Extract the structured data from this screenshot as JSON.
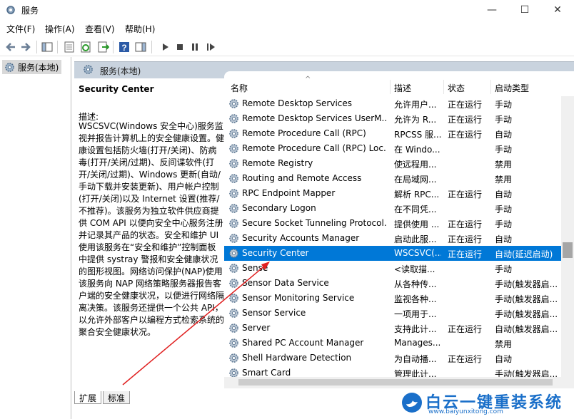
{
  "window": {
    "title": "服务",
    "minimize_glyph": "—",
    "maximize_glyph": "☐",
    "close_glyph": "✕"
  },
  "menu": [
    "文件(F)",
    "操作(A)",
    "查看(V)",
    "帮助(H)"
  ],
  "toolbar": {
    "icons": [
      "back-arrow-icon",
      "forward-arrow-icon",
      "show-hide-tree-icon",
      "properties-icon",
      "refresh-icon",
      "export-list-icon",
      "help-icon",
      "show-action-pane-icon",
      "start-service-icon",
      "stop-service-icon",
      "pause-service-icon",
      "restart-service-icon"
    ]
  },
  "tree": {
    "root_label": "服务(本地)"
  },
  "right_header": {
    "label": "服务(本地)"
  },
  "selected_service": {
    "title": "Security Center",
    "desc_label": "描述:",
    "description": "WSCSVC(Windows 安全中心)服务监视并报告计算机上的安全健康设置。健康设置包括防火墙(打开/关闭)、防病毒(打开/关闭/过期)、反间谍软件(打开/关闭/过期)、Windows 更新(自动/手动下载并安装更新)、用户帐户控制(打开/关闭)以及 Internet 设置(推荐/不推荐)。该服务为独立软件供应商提供 COM API 以便向安全中心服务注册并记录其产品的状态。安全和维护 UI 使用该服务在“安全和维护”控制面板中提供 systray 警报和安全健康状况的图形视图。网络访问保护(NAP)使用该服务向 NAP 网络策略服务器报告客户端的安全健康状况，以便进行网络隔离决策。该服务还提供一个公共 API，以允许外部客户以编程方式检索系统的聚合安全健康状况。"
  },
  "list": {
    "columns": {
      "name": "名称",
      "desc": "描述",
      "status": "状态",
      "startup": "启动类型"
    },
    "sort_arrow": "^",
    "rows": [
      {
        "name": "Remote Desktop Services",
        "desc": "允许用户...",
        "status": "正在运行",
        "startup": "手动"
      },
      {
        "name": "Remote Desktop Services UserM...",
        "desc": "允许为 R...",
        "status": "正在运行",
        "startup": "手动"
      },
      {
        "name": "Remote Procedure Call (RPC)",
        "desc": "RPCSS 服...",
        "status": "正在运行",
        "startup": "自动"
      },
      {
        "name": "Remote Procedure Call (RPC) Loc...",
        "desc": "在 Windo...",
        "status": "",
        "startup": "手动"
      },
      {
        "name": "Remote Registry",
        "desc": "使远程用...",
        "status": "",
        "startup": "禁用"
      },
      {
        "name": "Routing and Remote Access",
        "desc": "在局域网...",
        "status": "",
        "startup": "禁用"
      },
      {
        "name": "RPC Endpoint Mapper",
        "desc": "解析 RPC...",
        "status": "正在运行",
        "startup": "自动"
      },
      {
        "name": "Secondary Logon",
        "desc": "在不同凭...",
        "status": "",
        "startup": "手动"
      },
      {
        "name": "Secure Socket Tunneling Protocol...",
        "desc": "提供使用 ...",
        "status": "正在运行",
        "startup": "手动"
      },
      {
        "name": "Security Accounts Manager",
        "desc": "启动此服...",
        "status": "正在运行",
        "startup": "自动"
      },
      {
        "name": "Security Center",
        "desc": "WSCSVC(...",
        "status": "正在运行",
        "startup": "自动(延迟启动)",
        "selected": true
      },
      {
        "name": "Sense",
        "desc": "<读取描...",
        "status": "",
        "startup": "手动"
      },
      {
        "name": "Sensor Data Service",
        "desc": "从各种传...",
        "status": "",
        "startup": "手动(触发器启..."
      },
      {
        "name": "Sensor Monitoring Service",
        "desc": "监视各种...",
        "status": "",
        "startup": "手动(触发器启..."
      },
      {
        "name": "Sensor Service",
        "desc": "一项用于...",
        "status": "",
        "startup": "手动(触发器启..."
      },
      {
        "name": "Server",
        "desc": "支持此计...",
        "status": "正在运行",
        "startup": "自动(触发器启..."
      },
      {
        "name": "Shared PC Account Manager",
        "desc": "Manages...",
        "status": "",
        "startup": "禁用"
      },
      {
        "name": "Shell Hardware Detection",
        "desc": "为自动播...",
        "status": "正在运行",
        "startup": "自动"
      },
      {
        "name": "Smart Card",
        "desc": "管理此计...",
        "status": "",
        "startup": "手动(触发器启..."
      }
    ]
  },
  "tabs": {
    "extended": "扩展",
    "standard": "标准"
  },
  "watermark": {
    "text": "白云一键重装系统",
    "url": "www.baiyunxitong.com"
  },
  "colors": {
    "selection": "#0078d7",
    "header_band": "#c9d3de",
    "annotation_arrow": "#e02020"
  }
}
